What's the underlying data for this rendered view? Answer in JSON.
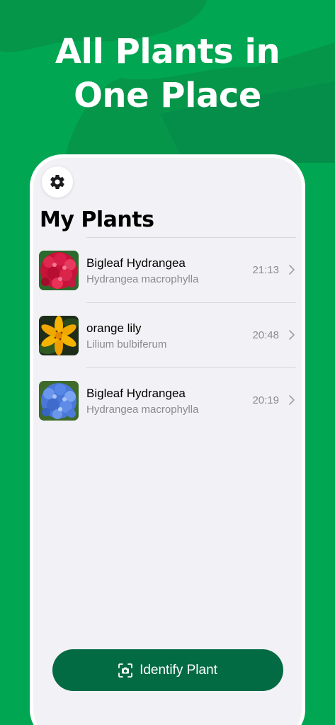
{
  "colors": {
    "background": "#00a651",
    "background_shape": "#05964a",
    "card": "#f2f2f6",
    "accent_button": "#036b43",
    "secondary_text": "#8a8a8f"
  },
  "headline": {
    "line1": "All Plants in",
    "line2": "One Place"
  },
  "screen": {
    "settings_icon": "gear-icon",
    "title": "My Plants",
    "plants": [
      {
        "name": "Bigleaf Hydrangea",
        "scientific": "Hydrangea macrophylla",
        "time": "21:13",
        "photo": "red hydrangea"
      },
      {
        "name": "orange lily",
        "scientific": "Lilium bulbiferum",
        "time": "20:48",
        "photo": "orange lily"
      },
      {
        "name": "Bigleaf Hydrangea",
        "scientific": "Hydrangea macrophylla",
        "time": "20:19",
        "photo": "blue hydrangea"
      }
    ],
    "identify_button": {
      "label": "Identify Plant",
      "icon": "camera-scan-icon"
    }
  }
}
